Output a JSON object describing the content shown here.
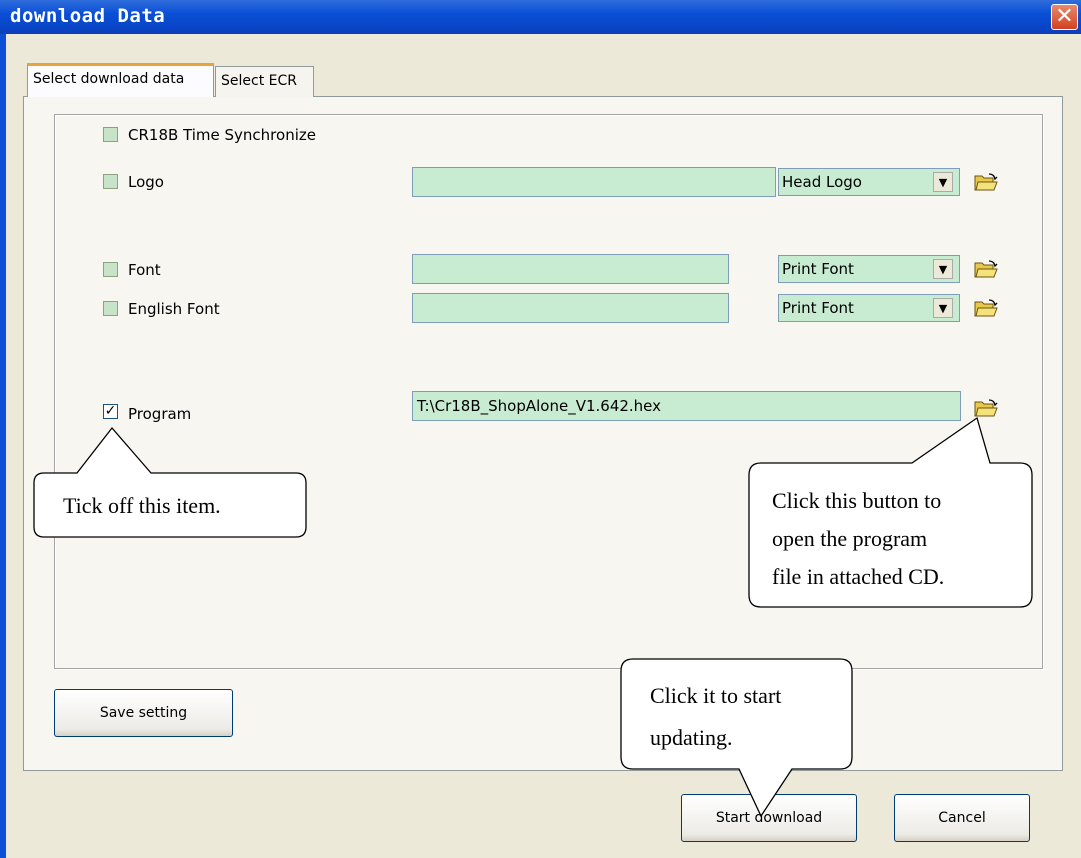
{
  "window": {
    "title": "download Data",
    "close_icon": "close-icon"
  },
  "tabs": [
    {
      "label": "Select download data",
      "active": true
    },
    {
      "label": "Select ECR",
      "active": false
    }
  ],
  "rows": {
    "time_sync": {
      "label": "CR18B Time Synchronize",
      "checked": false
    },
    "logo": {
      "label": "Logo",
      "checked": false,
      "path": "",
      "option": "Head Logo"
    },
    "font": {
      "label": "Font",
      "checked": false,
      "path": "",
      "option": "Print Font"
    },
    "english_font": {
      "label": "English Font",
      "checked": false,
      "path": "",
      "option": "Print Font"
    },
    "program": {
      "label": "Program",
      "checked": true,
      "path": "T:\\Cr18B_ShopAlone_V1.642.hex"
    }
  },
  "buttons": {
    "save": "Save setting",
    "start": "Start download",
    "cancel": "Cancel"
  },
  "callouts": {
    "tick": "Tick off this item.",
    "open_line1": "Click this button to",
    "open_line2": "open the program",
    "open_line3": "file in attached CD.",
    "start_line1": "Click it to start",
    "start_line2": "updating."
  },
  "colors": {
    "field_bg": "#c8ecd2",
    "titlebar": "#0a4fd6",
    "dialog_bg": "#ece9d8"
  }
}
